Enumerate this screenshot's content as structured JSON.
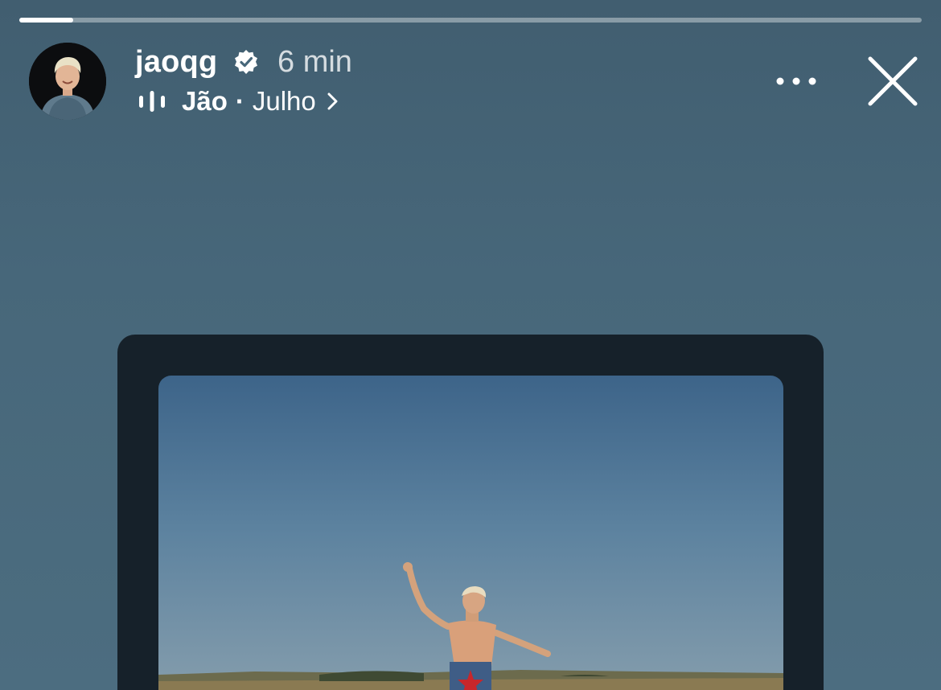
{
  "story": {
    "progress_fraction": 0.06
  },
  "header": {
    "username": "jaoqg",
    "verified": true,
    "time_ago": "6 min",
    "music": {
      "artist": "Jão",
      "separator": "·",
      "song": "Julho"
    }
  },
  "icons": {
    "verified": "verified-badge-icon",
    "music": "audio-bars-icon",
    "chevron": "chevron-right-icon",
    "more": "more-dots-icon",
    "close": "close-icon"
  },
  "colors": {
    "background": "#47677a",
    "frame": "#16212a",
    "text": "#ffffff"
  }
}
